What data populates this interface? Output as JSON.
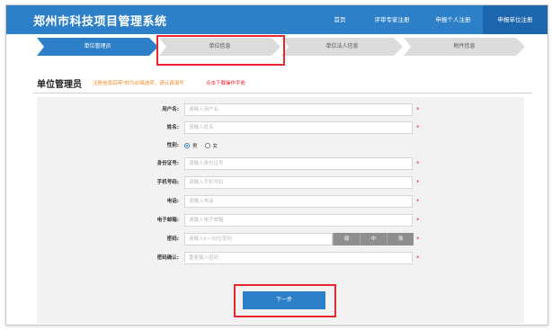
{
  "app": {
    "title": "郑州市科技项目管理系统"
  },
  "nav": [
    {
      "label": "首页",
      "active": false
    },
    {
      "label": "评审专家注册",
      "active": false
    },
    {
      "label": "申报个人注册",
      "active": false
    },
    {
      "label": "申报单位注册",
      "active": true
    }
  ],
  "steps": [
    {
      "label": "单位管理员",
      "active": true
    },
    {
      "label": "单位信息",
      "active": false
    },
    {
      "label": "单位法人信息",
      "active": false
    },
    {
      "label": "附件信息",
      "active": false
    }
  ],
  "section": {
    "title": "单位管理员",
    "notice": "注册信息后带*的为必填选项，请认真填写",
    "manual_link": "点击下载操作手册"
  },
  "form": {
    "username": {
      "label": "用户名:",
      "placeholder": "请输入用户名",
      "required": "*"
    },
    "name": {
      "label": "姓名:",
      "placeholder": "请输入姓名",
      "required": "*"
    },
    "gender": {
      "label": "性别:",
      "options": [
        "男",
        "女"
      ],
      "selected": "男"
    },
    "id_number": {
      "label": "身份证号:",
      "placeholder": "请输入身份证号",
      "required": "*"
    },
    "phone": {
      "label": "手机号码:",
      "placeholder": "请输入手机号码",
      "required": "*"
    },
    "telephone": {
      "label": "电话:",
      "placeholder": "请输入电话",
      "required": "*"
    },
    "email": {
      "label": "电子邮箱:",
      "placeholder": "请输入电子邮箱",
      "required": "*"
    },
    "password": {
      "label": "密码:",
      "placeholder": "请输入6~30位密码",
      "required": "*",
      "strength": [
        "弱",
        "中",
        "强"
      ]
    },
    "password_confirm": {
      "label": "密码确认:",
      "placeholder": "重复输入密码",
      "required": "*"
    }
  },
  "actions": {
    "next_label": "下一步"
  },
  "colors": {
    "primary": "#2d80c8",
    "nav_active": "#1b66ac",
    "highlight": "#e8262e",
    "notice": "#f08a24"
  }
}
